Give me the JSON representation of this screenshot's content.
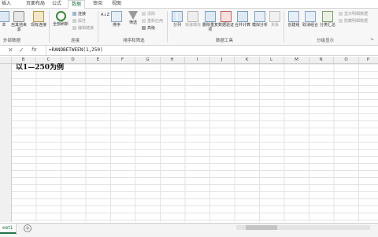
{
  "tabs": [
    "插入",
    "页面布局",
    "公式",
    "数据",
    "审阅",
    "视图"
  ],
  "ribbon": {
    "get_external": [
      "本",
      "自其他来源",
      "现有连接"
    ],
    "get_external_group": "外部数据",
    "refresh_all": "全部刷新",
    "connections": [
      "连接",
      "属性",
      "编辑链接"
    ],
    "connections_group": "连接",
    "sort_az": "A↓Z",
    "sort": "排序",
    "filter": "筛选",
    "filter_opts": [
      "清除",
      "重新应用",
      "高级"
    ],
    "sort_filter_group": "排序和筛选",
    "split": "分列",
    "flash_fill": "快速填充",
    "remove_dup": "删除重复项",
    "validation": "数据验证",
    "consolidate": "合并计算",
    "whatif": "模拟分析",
    "relations": "关系",
    "data_tools_group": "数据工具",
    "group_btn": "创建组",
    "ungroup": "取消组合",
    "subtotal": "分类汇总",
    "outline_opts": [
      "显示明细数据",
      "隐藏明细数据"
    ],
    "outline_group": "分级显示"
  },
  "formula_bar": {
    "cancel": "✕",
    "confirm": "✓",
    "fx": "fx",
    "formula": "=RANDBETWEEN(1,250)"
  },
  "columns": [
    "B",
    "C",
    "D",
    "E",
    "F",
    "G",
    "H",
    "I",
    "J",
    "K",
    "L",
    "M",
    "N",
    "O",
    "P"
  ],
  "cell_text": "以1—250为例",
  "sheet_tab": "eet1",
  "add_sheet": "+",
  "colors": {
    "accent": "#217346"
  }
}
